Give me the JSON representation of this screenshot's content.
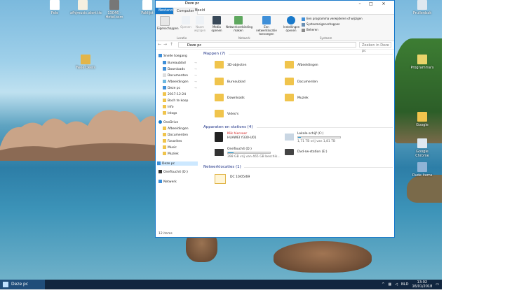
{
  "desktop": {
    "icons": [
      {
        "label": "Polo"
      },
      {
        "label": "afhjmusic.alert.ttc"
      },
      {
        "label": "13046 - Hotel.ssm"
      },
      {
        "label": "Paklijst"
      },
      {
        "label": "Twee Deels"
      },
      {
        "label": "Prullenbak"
      },
      {
        "label": "Programma's"
      },
      {
        "label": "Google"
      },
      {
        "label": "Google Chrome"
      },
      {
        "label": "Oude items"
      }
    ]
  },
  "taskbar": {
    "start_label": "Deze pc",
    "language": "NLD",
    "time": "13:02",
    "date": "16/01/2018"
  },
  "window": {
    "title": "Deze pc",
    "controls": [
      "–",
      "□",
      "×"
    ],
    "tabs": [
      "Bestand",
      "Computer",
      "Beeld"
    ],
    "ribbon": {
      "buttons": [
        {
          "label": "Eigenschappen"
        },
        {
          "label": "Openen"
        },
        {
          "label": "Naam wijzigen"
        },
        {
          "label": "Media openen"
        },
        {
          "label": "Netwerkverbinding maken"
        },
        {
          "label": "Een netwerklocatie toevoegen"
        },
        {
          "label": "Instellingen openen"
        }
      ],
      "small_buttons": [
        {
          "label": "Een programma verwijderen of wijzigen"
        },
        {
          "label": "Systeemeigenschappen"
        },
        {
          "label": "Beheren"
        }
      ],
      "groups": [
        "Locatie",
        "Netwerk",
        "Systeem"
      ]
    },
    "address": {
      "path": "Deze pc",
      "search_placeholder": "Zoeken in Deze pc"
    },
    "nav": {
      "items": [
        {
          "label": "Snelle toegang"
        },
        {
          "label": "Bureaublad"
        },
        {
          "label": "Downloads"
        },
        {
          "label": "Documenten"
        },
        {
          "label": "Afbeeldingen"
        },
        {
          "label": "Deze pc"
        },
        {
          "label": "2017-12-24"
        },
        {
          "label": "Boch te koop"
        },
        {
          "label": "Info"
        },
        {
          "label": "Inlogs"
        },
        {
          "label": "OneDrive"
        },
        {
          "label": "Afbeeldingen"
        },
        {
          "label": "Documenten"
        },
        {
          "label": "Favorites"
        },
        {
          "label": "Music"
        },
        {
          "label": "Muziek"
        },
        {
          "label": "Deze pc"
        },
        {
          "label": "OneTouch4 (D:)"
        },
        {
          "label": "Netwerk"
        }
      ]
    },
    "content": {
      "folders_header": "Mappen (7)",
      "folders": [
        {
          "label": "3D-objecten"
        },
        {
          "label": "Afbeeldingen"
        },
        {
          "label": "Bureaublad"
        },
        {
          "label": "Documenten"
        },
        {
          "label": "Downloads"
        },
        {
          "label": "Muziek"
        },
        {
          "label": "Video's"
        }
      ],
      "devices_header": "Apparaten en stations (4)",
      "devices": [
        {
          "label": "Klik hiervoor",
          "sub": "HUAWEI Y330-U01"
        },
        {
          "label": "Lokale schijf (C:)",
          "sub": "1,71 TB vrij van 1,81 TB",
          "used": 0.06
        },
        {
          "label": "OneTouch4 (D:)",
          "sub": "398 GB vrij van 465 GB beschik...",
          "used": 0.14
        },
        {
          "label": "Dvd-rw-station (E:)"
        }
      ],
      "network_header": "Netwerklocaties (1)",
      "network": [
        {
          "label": "DC 10/05/69"
        }
      ]
    },
    "status": "12 items"
  }
}
